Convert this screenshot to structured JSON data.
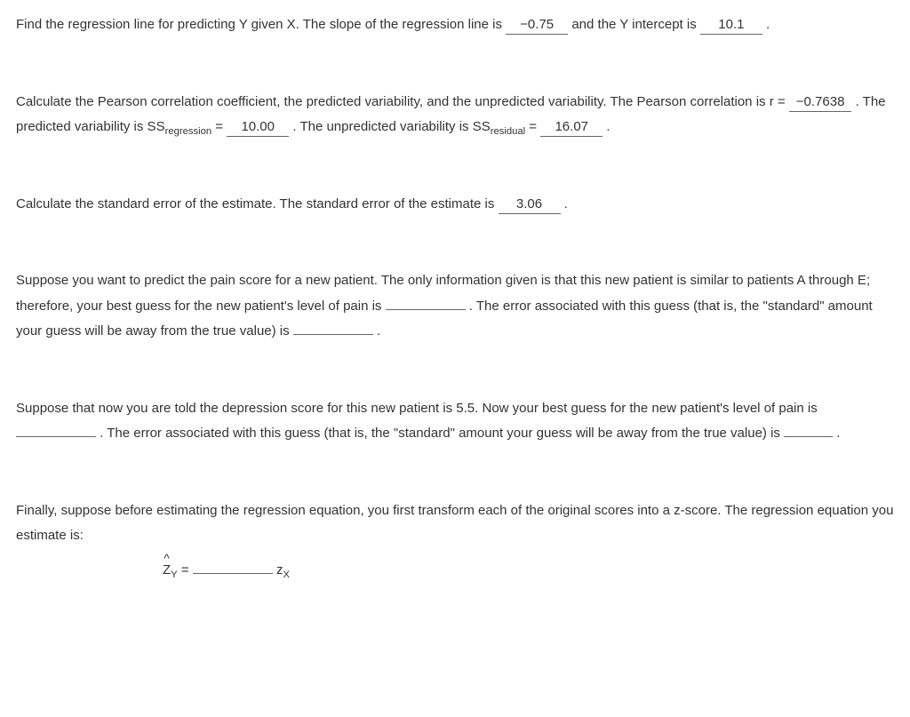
{
  "p1": {
    "t1": "Find the regression line for predicting Y given X. The slope of the regression line is ",
    "slope": "−0.75",
    "t2": " and the Y intercept is ",
    "intercept": "10.1",
    "t3": " ."
  },
  "p2": {
    "t1": "Calculate the Pearson correlation coefficient, the predicted variability, and the unpredicted variability. The Pearson correlation is r = ",
    "r": "−0.7638",
    "t2": " . The predicted variability is SS",
    "sub1": "regression",
    "t3": " = ",
    "ssreg": "10.00",
    "t4": " . The unpredicted variability is SS",
    "sub2": "residual",
    "t5": " = ",
    "ssres": "16.07",
    "t6": " ."
  },
  "p3": {
    "t1": "Calculate the standard error of the estimate. The standard error of the estimate is ",
    "se": "3.06",
    "t2": " ."
  },
  "p4": {
    "t1": "Suppose you want to predict the pain score for a new patient. The only information given is that this new patient is similar to patients A through E; therefore, your best guess for the new patient's level of pain is ",
    "t2": " . The error associated with this guess (that is, the \"standard\" amount your guess will be away from the true value) is ",
    "t3": " ."
  },
  "p5": {
    "t1": "Suppose that now you are told the depression score for this new patient is 5.5. Now your best guess for the new patient's level of pain is ",
    "t2": " . The error associated with this guess (that is, the \"standard\" amount your guess will be away from the true value) is ",
    "t3": " ."
  },
  "p6": {
    "t1": "Finally, suppose before estimating the regression equation, you first transform each of the original scores into a z-score. The regression equation you estimate is:",
    "zy": "Z",
    "zy_sub": "Y",
    "eq": " = ",
    "zx": " z",
    "zx_sub": "X"
  }
}
